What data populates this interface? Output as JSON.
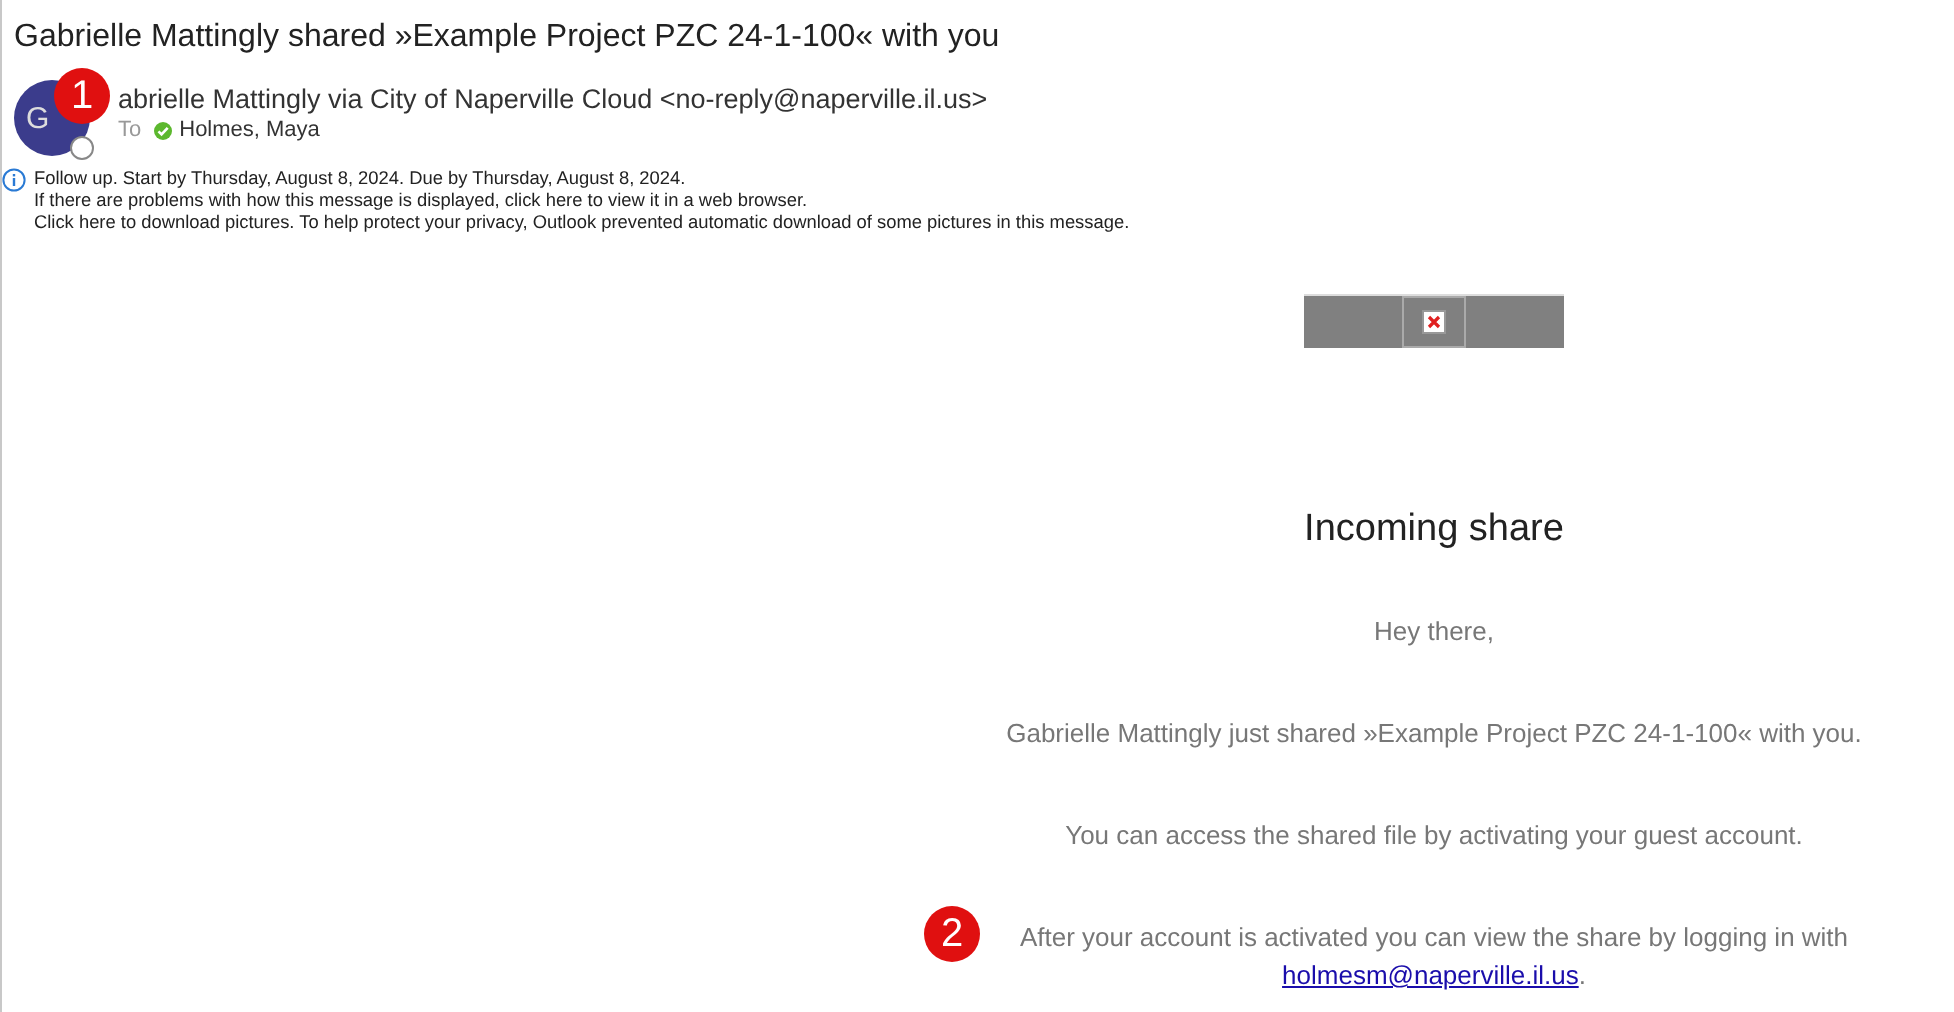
{
  "subject": "Gabrielle Mattingly shared »Example Project PZC 24-1-100« with you",
  "sender": {
    "initials": "G",
    "name": "abrielle Mattingly via City of Naperville Cloud <no-reply@naperville.il.us>",
    "to_label": "To",
    "recipient": "Holmes, Maya"
  },
  "callouts": [
    {
      "number": "1"
    },
    {
      "number": "2"
    }
  ],
  "infobar": [
    "Follow up.  Start by Thursday, August 8, 2024.  Due by Thursday, August 8, 2024.",
    "If there are problems with how this message is displayed, click here to view it in a web browser.",
    "Click here to download pictures. To help protect your privacy, Outlook prevented automatic download of some pictures in this message."
  ],
  "body": {
    "heading": "Incoming share",
    "paragraphs": [
      {
        "text": "Hey there,"
      },
      {
        "text": "Gabrielle Mattingly just shared »Example Project PZC 24-1-100« with you."
      },
      {
        "text": "You can access the shared file by activating your guest account."
      },
      {
        "text": "After your account is activated you can view the share by logging in with",
        "link": "holmesm@naperville.il.us",
        "after": "."
      }
    ]
  }
}
